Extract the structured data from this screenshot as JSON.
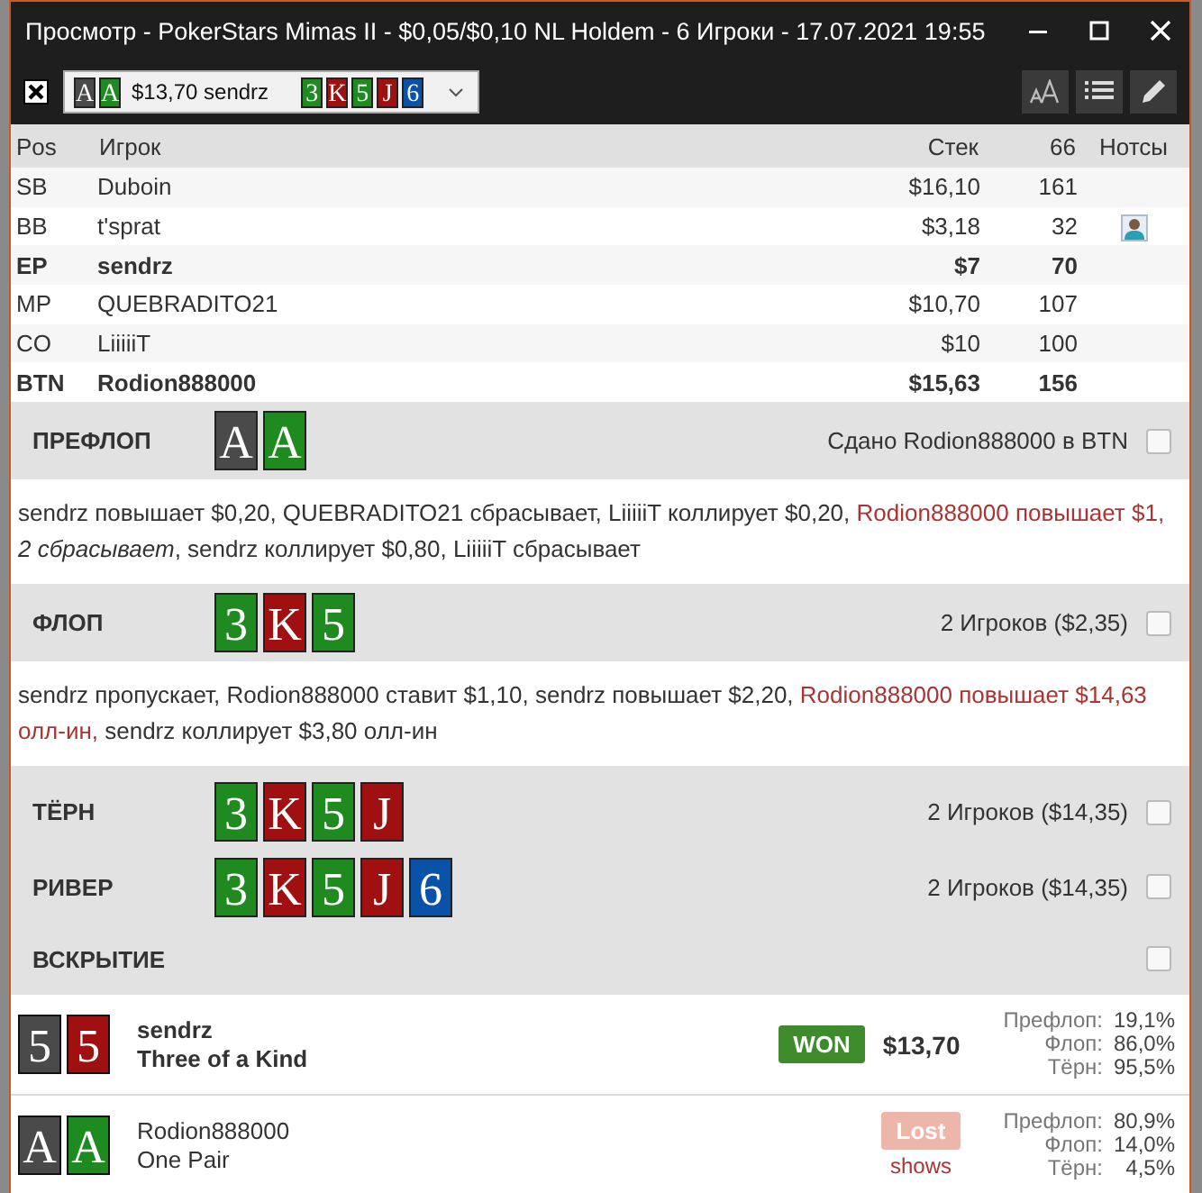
{
  "window": {
    "title": "Просмотр - PokerStars Mimas II - $0,05/$0,10 NL Holdem - 6 Игроки - 17.07.2021 19:55"
  },
  "toolbar": {
    "hand_selector": {
      "hole_cards": [
        {
          "rank": "A",
          "color": "#4a4a4a"
        },
        {
          "rank": "A",
          "color": "#1f8a1f"
        }
      ],
      "label": "$13,70 sendrz",
      "board": [
        {
          "rank": "3",
          "color": "#1f8a1f"
        },
        {
          "rank": "K",
          "color": "#a01010"
        },
        {
          "rank": "5",
          "color": "#1f8a1f"
        },
        {
          "rank": "J",
          "color": "#a01010"
        },
        {
          "rank": "6",
          "color": "#0a52a8"
        }
      ]
    }
  },
  "table": {
    "columns": [
      "Pos",
      "Игрок",
      "Стек",
      "66",
      "Нотсы"
    ],
    "rows": [
      {
        "pos": "SB",
        "player": "Duboin",
        "stack": "$16,10",
        "value": "161",
        "bold": false,
        "has_note": false
      },
      {
        "pos": "BB",
        "player": "t'sprat",
        "stack": "$3,18",
        "value": "32",
        "bold": false,
        "has_note": true
      },
      {
        "pos": "EP",
        "player": "sendrz",
        "stack": "$7",
        "value": "70",
        "bold": true,
        "has_note": false
      },
      {
        "pos": "MP",
        "player": "QUEBRADITO21",
        "stack": "$10,70",
        "value": "107",
        "bold": false,
        "has_note": false
      },
      {
        "pos": "CO",
        "player": "LiiiiiT",
        "stack": "$10",
        "value": "100",
        "bold": false,
        "has_note": false
      },
      {
        "pos": "BTN",
        "player": "Rodion888000",
        "stack": "$15,63",
        "value": "156",
        "bold": true,
        "has_note": false
      }
    ]
  },
  "streets": [
    {
      "name": "ПРЕФЛОП",
      "cards": [
        {
          "rank": "A",
          "color": "#4a4a4a"
        },
        {
          "rank": "A",
          "color": "#1f8a1f"
        }
      ],
      "summary": "Сдано Rodion888000 в BTN",
      "checked": false,
      "actions": [
        {
          "text": "sendrz повышает $0,20, QUEBRADITO21 сбрасывает, LiiiiiT коллирует $0,20, ",
          "kind": "normal"
        },
        {
          "text": "Rodion888000 повышает $1,",
          "kind": "hero"
        },
        {
          "text": " 2 сбрасывает",
          "kind": "folded"
        },
        {
          "text": ", sendrz коллирует $0,80, LiiiiiT сбрасывает",
          "kind": "normal"
        }
      ]
    },
    {
      "name": "ФЛОП",
      "cards": [
        {
          "rank": "3",
          "color": "#1f8a1f"
        },
        {
          "rank": "K",
          "color": "#a01010"
        },
        {
          "rank": "5",
          "color": "#1f8a1f"
        }
      ],
      "summary": "2 Игроков ($2,35)",
      "checked": false,
      "actions": [
        {
          "text": "sendrz пропускает, Rodion888000 ставит $1,10, sendrz повышает $2,20, ",
          "kind": "normal"
        },
        {
          "text": "Rodion888000 повышает $14,63 олл-ин,",
          "kind": "hero"
        },
        {
          "text": " sendrz коллирует $3,80 олл-ин",
          "kind": "normal"
        }
      ]
    },
    {
      "name": "ТЁРН",
      "cards": [
        {
          "rank": "3",
          "color": "#1f8a1f"
        },
        {
          "rank": "K",
          "color": "#a01010"
        },
        {
          "rank": "5",
          "color": "#1f8a1f"
        },
        {
          "rank": "J",
          "color": "#a01010"
        }
      ],
      "summary": "2 Игроков ($14,35)",
      "checked": false
    },
    {
      "name": "РИВЕР",
      "cards": [
        {
          "rank": "3",
          "color": "#1f8a1f"
        },
        {
          "rank": "K",
          "color": "#a01010"
        },
        {
          "rank": "5",
          "color": "#1f8a1f"
        },
        {
          "rank": "J",
          "color": "#a01010"
        },
        {
          "rank": "6",
          "color": "#0a52a8"
        }
      ],
      "summary": "2 Игроков ($14,35)",
      "checked": false
    },
    {
      "name": "ВСКРЫТИЕ",
      "checked": false
    }
  ],
  "showdown": [
    {
      "cards": [
        {
          "rank": "5",
          "color": "#4a4a4a"
        },
        {
          "rank": "5",
          "color": "#a01010"
        }
      ],
      "player": "sendrz",
      "hand": "Three of a Kind",
      "bold": true,
      "result": {
        "kind": "won",
        "label": "WON",
        "amount": "$13,70"
      },
      "equity": [
        {
          "label": "Префлоп:",
          "value": "19,1%"
        },
        {
          "label": "Флоп:",
          "value": "86,0%"
        },
        {
          "label": "Тёрн:",
          "value": "95,5%"
        }
      ]
    },
    {
      "cards": [
        {
          "rank": "A",
          "color": "#4a4a4a"
        },
        {
          "rank": "A",
          "color": "#1f8a1f"
        }
      ],
      "player": "Rodion888000",
      "hand": "One Pair",
      "bold": false,
      "result": {
        "kind": "lost",
        "label": "Lost",
        "note": "shows"
      },
      "equity": [
        {
          "label": "Префлоп:",
          "value": "80,9%"
        },
        {
          "label": "Флоп:",
          "value": "14,0%"
        },
        {
          "label": "Тёрн:",
          "value": "4,5%"
        }
      ]
    }
  ]
}
